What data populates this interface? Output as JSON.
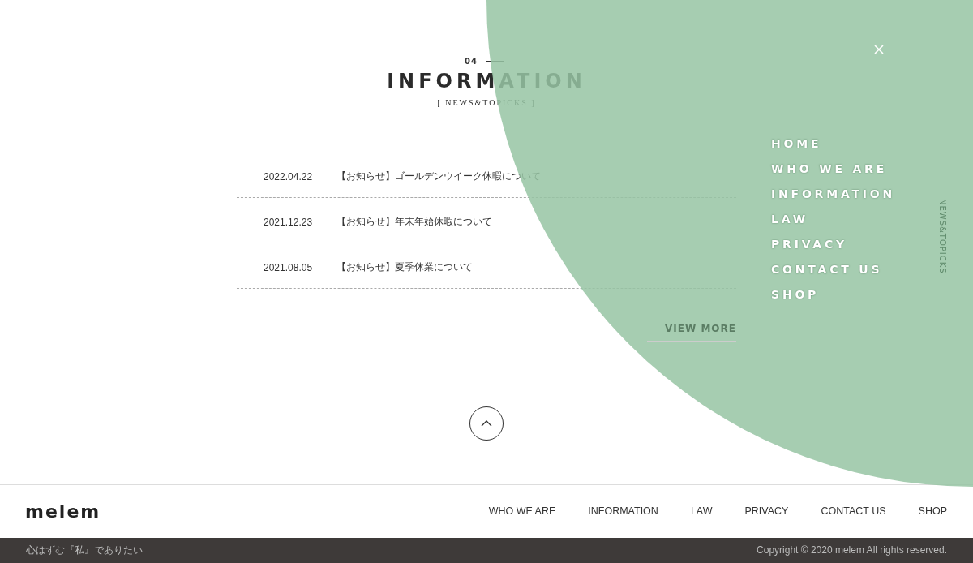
{
  "section": {
    "number": "04",
    "title": "INFORMATION",
    "subtitle": "[ NEWS&TOPICKS ]"
  },
  "news": [
    {
      "date": "2022.04.22",
      "title": "【お知らせ】ゴールデンウイーク休暇について"
    },
    {
      "date": "2021.12.23",
      "title": "【お知らせ】年末年始休暇について"
    },
    {
      "date": "2021.08.05",
      "title": "【お知らせ】夏季休業について"
    }
  ],
  "view_more": "VIEW MORE",
  "menu": {
    "items": [
      "HOME",
      "WHO WE ARE",
      "INFORMATION",
      "LAW",
      "PRIVACY",
      "CONTACT US",
      "SHOP"
    ],
    "side_label": "NEWS&TOPICKS"
  },
  "footer": {
    "logo": "melem",
    "nav": [
      "WHO WE ARE",
      "INFORMATION",
      "LAW",
      "PRIVACY",
      "CONTACT US",
      "SHOP"
    ],
    "tagline": "心はずむ『私』でありたい",
    "copyright": "Copyright © 2020 melem All rights reserved."
  }
}
